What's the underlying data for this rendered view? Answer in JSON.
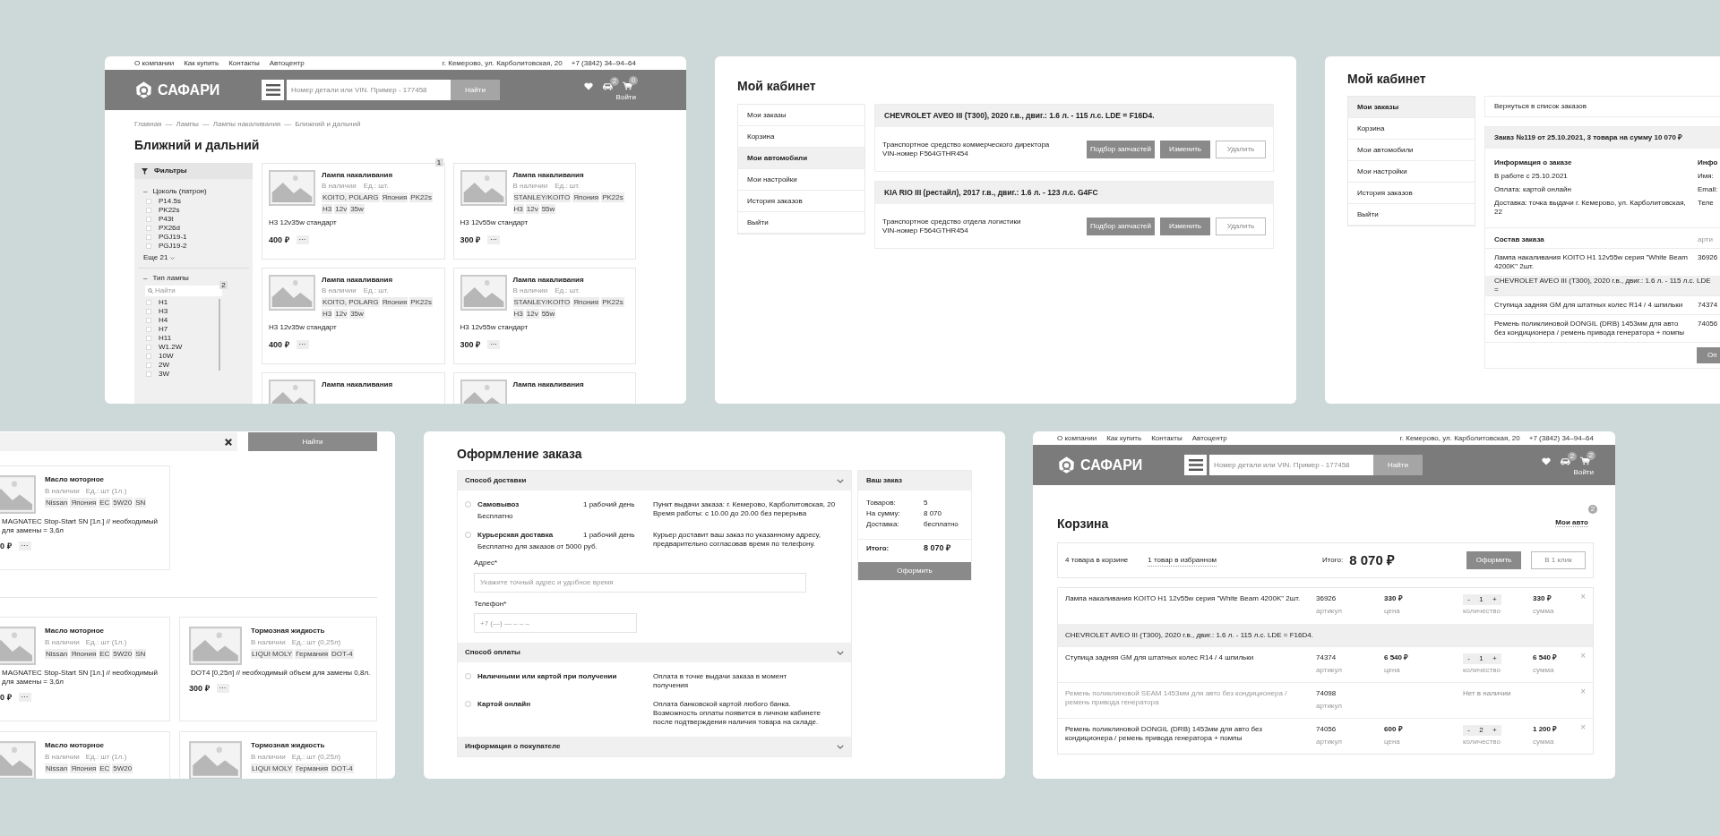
{
  "screens": [
    {
      "kind": "catalog",
      "header": {
        "top_links": [
          "О компании",
          "Как купить",
          "Контакты",
          "Автоцентр"
        ],
        "address": "г. Кемерово, ул. Карболитовская, 20",
        "phone": "+7 (3842) 34–94–64",
        "logo": "САФАРИ",
        "search_placeholder": "Номер детали или VIN. Пример - 177458",
        "search_button": "Найти",
        "garage_badge": "2",
        "cart_badge": "0",
        "login": "Войти"
      },
      "breadcrumbs": [
        "Главная",
        "—",
        "Лампы",
        "—",
        "Лампы накаливания",
        "—",
        "Ближний и дальний"
      ],
      "title": "Ближний и дальний",
      "filters": {
        "title": "Фильтры",
        "groups": [
          {
            "toggle": "–",
            "name": "Цоколь (патрон)",
            "options": [
              {
                "label": "P14.5s",
                "checked": false
              },
              {
                "label": "PK22s",
                "checked": false
              },
              {
                "label": "P43t",
                "checked": false
              },
              {
                "label": "PX26d",
                "checked": false
              },
              {
                "label": "PGJ19-1",
                "checked": false
              },
              {
                "label": "PGJ19-2",
                "checked": false
              }
            ],
            "more": "Еще 21"
          },
          {
            "toggle": "–",
            "name": "Тип лампы",
            "search_placeholder": "Найти",
            "badge": "2",
            "options": [
              {
                "label": "H1",
                "checked": false
              },
              {
                "label": "H3",
                "checked": false
              },
              {
                "label": "H4",
                "checked": false
              },
              {
                "label": "H7",
                "checked": false
              },
              {
                "label": "H11",
                "checked": false
              },
              {
                "label": "W1.2W",
                "checked": false
              },
              {
                "label": "10W",
                "checked": false
              },
              {
                "label": "2W",
                "checked": false
              },
              {
                "label": "3W",
                "checked": false
              }
            ]
          }
        ]
      },
      "products": [
        {
          "badge": "1",
          "title": "Лампа накаливания",
          "stock": "В наличии",
          "unit": "Ед.: шт.",
          "tags": [
            "KOITO, POLARG",
            "Япония",
            "PK22s",
            "H3",
            "12v",
            "35w"
          ],
          "description": "H3 12v35w стандарт",
          "price": "400 ₽",
          "more": "···"
        },
        {
          "title": "Лампа накаливания",
          "stock": "В наличии",
          "unit": "Ед.: шт.",
          "tags": [
            "STANLEY/KOITO",
            "Япония",
            "PK22s",
            "H3",
            "12v",
            "55w"
          ],
          "description": "H3 12v55w стандарт",
          "price": "300 ₽",
          "more": "···"
        },
        {
          "title": "Лампа накаливания",
          "stock": "В наличии",
          "unit": "Ед.: шт.",
          "tags": [
            "KOITO, POLARG",
            "Япония",
            "PK22s",
            "H3",
            "12v",
            "35w"
          ],
          "description": "H3 12v35w стандарт",
          "price": "400 ₽",
          "more": "···"
        },
        {
          "title": "Лампа накаливания",
          "stock": "В наличии",
          "unit": "Ед.: шт.",
          "tags": [
            "STANLEY/KOITO",
            "Япония",
            "PK22s",
            "H3",
            "12v",
            "55w"
          ],
          "description": "H3 12v55w стандарт",
          "price": "300 ₽",
          "more": "···"
        },
        {
          "title": "Лампа накаливания"
        },
        {
          "title": "Лампа накаливания"
        }
      ]
    },
    {
      "kind": "garage",
      "title": "Мой кабинет",
      "menu": [
        {
          "label": "Мои заказы",
          "selected": false
        },
        {
          "label": "Корзина",
          "selected": false
        },
        {
          "label": "Мои автомобили",
          "selected": true
        },
        {
          "label": "Мои настройки",
          "selected": false
        },
        {
          "label": "История заказов",
          "selected": false
        },
        {
          "label": "Выйти",
          "selected": false
        }
      ],
      "cars": [
        {
          "title": "CHEVROLET AVEO III (T300), 2020 г.в., двиг.: 1.6 л. - 115 л.с. LDE = F16D4.",
          "description": [
            "Транспортное средство коммерческого директора",
            "VIN-номер F564GTHR454"
          ],
          "buttons": [
            {
              "label": "Подбор запчастей",
              "kind": "filled"
            },
            {
              "label": "Изменить",
              "kind": "filled"
            },
            {
              "label": "Удалить",
              "kind": "outline"
            }
          ]
        },
        {
          "title": "KIA RIO III (рестайл), 2017 г.в., двиг.: 1.6 л. - 123 л.с. G4FC",
          "description": [
            "Транспортное средство отдела логистики",
            "VIN-номер F564GTHR454"
          ],
          "buttons": [
            {
              "label": "Подбор запчастей",
              "kind": "filled"
            },
            {
              "label": "Изменить",
              "kind": "filled"
            },
            {
              "label": "Удалить",
              "kind": "outline"
            }
          ]
        }
      ]
    },
    {
      "kind": "order",
      "title": "Мой кабинет",
      "menu": [
        {
          "label": "Мои заказы",
          "selected": true
        },
        {
          "label": "Корзина",
          "selected": false
        },
        {
          "label": "Мои автомобили",
          "selected": false
        },
        {
          "label": "Мои настройки",
          "selected": false
        },
        {
          "label": "История заказов",
          "selected": false
        },
        {
          "label": "Выйти",
          "selected": false
        }
      ],
      "back_link": "Вернуться в список заказов",
      "order_title": "Заказ №119 от 25.10.2021, 3 товара на сумму 10 070 ₽",
      "info_blocks": [
        {
          "title": "Информация о заказе",
          "lines": [
            "В работе с 25.10.2021",
            "Оплата: картой онлайн",
            "Доставка: точка выдачи г. Кемерово, ул. Карболитовская, 22"
          ]
        },
        {
          "title": "Инфо",
          "lines": [
            "Имя:",
            "Email:",
            "Теле"
          ]
        }
      ],
      "items_title": "Состав заказа",
      "items_column": "арти",
      "items": [
        {
          "kind": "item",
          "name": "Лампа накаливания KOITO H1 12v55w серия \"White Beam 4200K\" 2шт.",
          "article": "36926"
        },
        {
          "kind": "car",
          "name": "CHEVROLET AVEO III (T300), 2020 г.в., двиг.: 1.6 л. - 115 л.с. LDE ="
        },
        {
          "kind": "item",
          "name": "Ступица задняя GM для штатных колес R14 / 4 шпильки",
          "article": "74374"
        },
        {
          "kind": "item",
          "name": "Ремень поликлиновой DONGIL (DRB) 1453мм для авто без кондиционера / ремень привода генератора + помпы",
          "article": "74056"
        }
      ],
      "button": "Оп"
    },
    {
      "kind": "search_results",
      "search_button": "Найти",
      "rows": [
        {
          "cards": [
            {
              "title": "Масло моторное",
              "stock": "В наличии",
              "unit": "Ед.: шт (1л.)",
              "tags": [
                "Nissan",
                "Япония",
                "EC",
                "5W20",
                "SN"
              ],
              "description": [
                "MAGNATEC Stop-Start SN [1л.] // необходимый",
                "для замены = 3,6л"
              ],
              "price": "0 ₽",
              "more": "···"
            }
          ]
        },
        {
          "cards": [
            {
              "title": "Масло моторное",
              "stock": "В наличии",
              "unit": "Ед.: шт (1л.)",
              "tags": [
                "Nissan",
                "Япония",
                "EC",
                "5W20",
                "SN"
              ],
              "description": [
                "MAGNATEC Stop-Start SN [1л.] // необходимый",
                "для замены = 3,6л"
              ],
              "price": "0 ₽",
              "more": "···"
            },
            {
              "title": "Тормозная жидкость",
              "stock": "В наличии",
              "unit": "Ед.: шт (0,25л)",
              "tags": [
                "LIQUI MOLY",
                "Германия",
                "DOT-4"
              ],
              "description": [
                "DOT4 [0,25л] // необходимый объем для замены 0,8л."
              ],
              "price": "300 ₽",
              "more": "···"
            }
          ]
        },
        {
          "cards": [
            {
              "title": "Масло моторное",
              "stock": "В наличии",
              "unit": "Ед.: шт (1л.)",
              "tags": [
                "Nissan",
                "Япония",
                "EC",
                "5W20"
              ]
            },
            {
              "title": "Тормозная жидкость",
              "stock": "В наличии",
              "unit": "Ед.: шт (0,25л)",
              "tags": [
                "LIQUI MOLY",
                "Германия",
                "DOT-4"
              ]
            }
          ]
        }
      ]
    },
    {
      "kind": "checkout",
      "title": "Оформление заказа",
      "sections": [
        {
          "title": "Способ доставки",
          "options": [
            {
              "selected": false,
              "name": "Самовывоз",
              "note": "Бесплатно",
              "term": "1 рабочий день",
              "details": "Пункт выдачи заказа: г. Кемерово, Карболитовская, 20\nВремя работы: с 10.00 до 20.00 без перерыва"
            },
            {
              "selected": false,
              "name": "Курьерская доставка",
              "note": "Бесплатно для заказов от 5000 руб.",
              "term": "1 рабочий день",
              "details": "Курьер доставит ваш заказ по указанному адресу,\nпредварительно согласовав время по телефону."
            }
          ],
          "fields": [
            {
              "label": "Адрес*",
              "placeholder": "Укажите точный адрес и удобное время"
            },
            {
              "label": "Телефон*",
              "placeholder": "+7 (—) — – – –"
            }
          ]
        },
        {
          "title": "Способ оплаты",
          "options": [
            {
              "selected": false,
              "name": "Наличными или картой при получении",
              "details": "Оплата в точке выдачи заказа  в момент\nполучения"
            },
            {
              "selected": false,
              "name": "Картой онлайн",
              "details": "Оплата банковской картой любого банка.\nВозможность оплаты появится в личном кабинете\nпосле подтверждения наличия товара на складе."
            }
          ]
        },
        {
          "title": "Информация о покупателе"
        }
      ],
      "summary": {
        "title": "Ваш заказ",
        "rows": [
          {
            "label": "Товаров:",
            "value": "5"
          },
          {
            "label": "На сумму:",
            "value": "8 070"
          },
          {
            "label": "Доставка:",
            "value": "бесплатно"
          }
        ],
        "total_label": "Итого:",
        "total": "8 070 ₽",
        "button": "Оформить"
      }
    },
    {
      "kind": "cart",
      "header": {
        "top_links": [
          "О компании",
          "Как купить",
          "Контакты",
          "Автоцентр"
        ],
        "address": "г. Кемерово, ул. Карболитовская, 20",
        "phone": "+7 (3842) 34–94–64",
        "logo": "САФАРИ",
        "search_placeholder": "Номер детали или VIN. Пример - 177458",
        "search_button": "Найти",
        "garage_badge": "2",
        "cart_badge": "2",
        "login": "Войти"
      },
      "title": "Корзина",
      "my_cars": "Мои авто",
      "my_cars_badge": "2",
      "summary": {
        "in_cart": "4 товара в корзине",
        "favorites": "1 товар в избранном",
        "total_label": "Итого:",
        "total": "8 070 ₽",
        "buttons": [
          {
            "label": "Оформить",
            "kind": "filled"
          },
          {
            "label": "В 1 клик",
            "kind": "outline"
          }
        ]
      },
      "rows": [
        {
          "kind": "item",
          "available": true,
          "name": "Лампа накаливания KOITO H1 12v55w серия \"White Beam 4200K\" 2шт.",
          "article": "36926",
          "article_label": "артикул",
          "price": "330 ₽",
          "price_label": "цена",
          "minus": "-",
          "qty": "1",
          "plus": "+",
          "qty_label": "количество",
          "sum": "330 ₽",
          "sum_label": "сумма",
          "remove": "×"
        },
        {
          "kind": "car",
          "name": "CHEVROLET AVEO III (T300), 2020 г.в., двиг.: 1.6 л. - 115 л.с. LDE = F16D4."
        },
        {
          "kind": "item",
          "available": true,
          "name": "Ступица задняя GM для штатных колес R14 / 4 шпильки",
          "article": "74374",
          "article_label": "артикул",
          "price": "6 540 ₽",
          "price_label": "цена",
          "minus": "-",
          "qty": "1",
          "plus": "+",
          "qty_label": "количество",
          "sum": "6 540 ₽",
          "sum_label": "сумма",
          "remove": "×"
        },
        {
          "kind": "item",
          "available": false,
          "name": "Ремень поликлиновой SEAM 1453мм для авто без кондиционера / ремень привода генератора",
          "article": "74098",
          "article_label": "артикул",
          "status": "Нет в наличии",
          "remove": "×"
        },
        {
          "kind": "item",
          "available": true,
          "name": "Ремень поликлиновой DONGIL (DRB) 1453мм для авто без кондиционера / ремень привода генератора + помпы",
          "article": "74056",
          "article_label": "артикул",
          "price": "600 ₽",
          "price_label": "цена",
          "minus": "-",
          "qty": "2",
          "plus": "+",
          "qty_label": "количество",
          "sum": "1 200 ₽",
          "sum_label": "сумма",
          "remove": "×"
        }
      ]
    }
  ]
}
